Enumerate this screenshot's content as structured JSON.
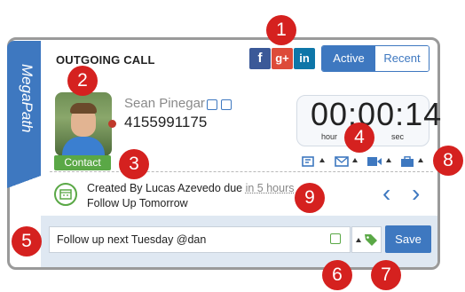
{
  "header": {
    "title": "OUTGOING CALL",
    "social": [
      {
        "label": "f",
        "icon": "facebook-icon",
        "color": "#3b5998"
      },
      {
        "label": "g+",
        "icon": "google-plus-icon",
        "color": "#dd4b39"
      },
      {
        "label": "in",
        "icon": "linkedin-icon",
        "color": "#0e76a8"
      }
    ],
    "toggle": {
      "active_label": "Active",
      "recent_label": "Recent"
    }
  },
  "brand": {
    "logo_text": "MegaPath",
    "color": "#3e78c0"
  },
  "contact": {
    "name": "Sean Pinegar",
    "phone": "4155991175",
    "badge": "Contact",
    "status_color": "#c0392b"
  },
  "timer": {
    "display": "00:00:14",
    "hour_label": "hour",
    "sec_label": "sec"
  },
  "tools": [
    "call-transfer-icon",
    "email-icon",
    "video-icon",
    "briefcase-icon"
  ],
  "task": {
    "created_prefix": "Created By Lucas Azevedo due ",
    "due": "in 5 hours",
    "subject": "Follow Up Tomorrow"
  },
  "composer": {
    "input_value": "Follow up next Tuesday @dan",
    "save_label": "Save"
  },
  "callouts": [
    "1",
    "2",
    "3",
    "4",
    "5",
    "6",
    "7",
    "8",
    "9"
  ],
  "colors": {
    "accent": "#3e78c0",
    "green": "#5aa846",
    "callout": "#d5211f"
  }
}
